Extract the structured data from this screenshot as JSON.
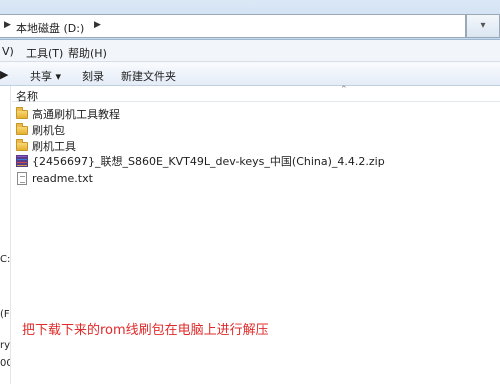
{
  "address": {
    "path": "本地磁盘 (D:)"
  },
  "menubar": {
    "view": "V)",
    "tools": "工具(T)",
    "help": "帮助(H)"
  },
  "toolbar": {
    "share": "共享 ▾",
    "burn": "刻录",
    "new_folder": "新建文件夹"
  },
  "navpane": {
    "items": [
      "C:",
      "(F",
      "ry",
      "00"
    ]
  },
  "columns": {
    "name": "名称"
  },
  "files": [
    {
      "name": "高通刷机工具教程",
      "type": "folder"
    },
    {
      "name": "刷机包",
      "type": "folder"
    },
    {
      "name": "刷机工具",
      "type": "folder"
    },
    {
      "name": "{2456697}_联想_S860E_KVT49L_dev-keys_中国(China)_4.4.2.zip",
      "type": "archive"
    },
    {
      "name": "readme.txt",
      "type": "text"
    }
  ],
  "annotation": "把下载下来的rom线刷包在电脑上进行解压"
}
